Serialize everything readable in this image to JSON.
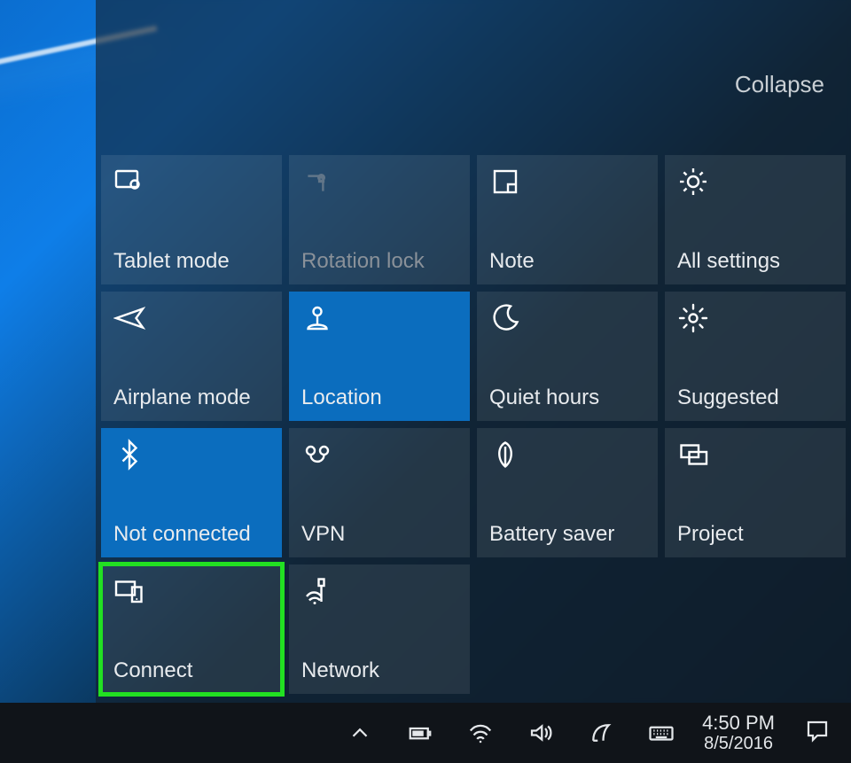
{
  "action_center": {
    "collapse_label": "Collapse",
    "tiles": [
      {
        "id": "tablet-mode",
        "label": "Tablet mode",
        "icon": "tablet-mode-icon",
        "active": false,
        "disabled": false,
        "highlight": false
      },
      {
        "id": "rotation-lock",
        "label": "Rotation lock",
        "icon": "rotation-lock-icon",
        "active": false,
        "disabled": true,
        "highlight": false
      },
      {
        "id": "note",
        "label": "Note",
        "icon": "note-icon",
        "active": false,
        "disabled": false,
        "highlight": false
      },
      {
        "id": "all-settings",
        "label": "All settings",
        "icon": "gear-icon",
        "active": false,
        "disabled": false,
        "highlight": false
      },
      {
        "id": "airplane-mode",
        "label": "Airplane mode",
        "icon": "airplane-icon",
        "active": false,
        "disabled": false,
        "highlight": false
      },
      {
        "id": "location",
        "label": "Location",
        "icon": "location-icon",
        "active": true,
        "disabled": false,
        "highlight": false
      },
      {
        "id": "quiet-hours",
        "label": "Quiet hours",
        "icon": "moon-icon",
        "active": false,
        "disabled": false,
        "highlight": false
      },
      {
        "id": "suggested",
        "label": "Suggested",
        "icon": "brightness-icon",
        "active": false,
        "disabled": false,
        "highlight": false
      },
      {
        "id": "bluetooth",
        "label": "Not connected",
        "icon": "bluetooth-icon",
        "active": true,
        "disabled": false,
        "highlight": false
      },
      {
        "id": "vpn",
        "label": "VPN",
        "icon": "vpn-icon",
        "active": false,
        "disabled": false,
        "highlight": false
      },
      {
        "id": "battery-saver",
        "label": "Battery saver",
        "icon": "leaf-icon",
        "active": false,
        "disabled": false,
        "highlight": false
      },
      {
        "id": "project",
        "label": "Project",
        "icon": "project-icon",
        "active": false,
        "disabled": false,
        "highlight": false
      },
      {
        "id": "connect",
        "label": "Connect",
        "icon": "connect-icon",
        "active": false,
        "disabled": false,
        "highlight": true
      },
      {
        "id": "network",
        "label": "Network",
        "icon": "network-icon",
        "active": false,
        "disabled": false,
        "highlight": false
      }
    ]
  },
  "taskbar": {
    "tray_icons": [
      "tray-overflow-icon",
      "battery-icon",
      "wifi-icon",
      "volume-icon",
      "pen-icon",
      "keyboard-icon"
    ],
    "time": "4:50 PM",
    "date": "8/5/2016",
    "action_center_icon": "action-center-icon"
  },
  "colors": {
    "accent": "#0b6dbe",
    "highlight": "#22e022"
  }
}
